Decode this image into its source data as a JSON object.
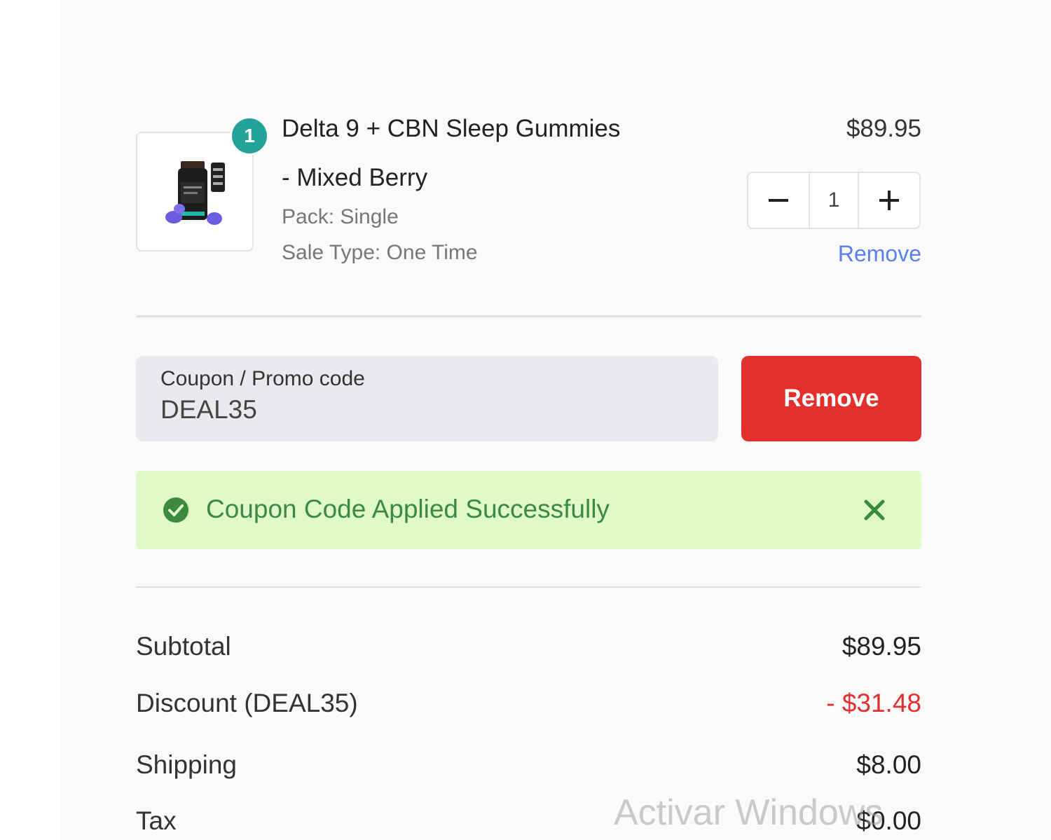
{
  "cart": {
    "item": {
      "quantity_badge": "1",
      "title_line1": "Delta 9 + CBN Sleep Gummies",
      "title_line2": "- Mixed Berry",
      "pack": "Pack: Single",
      "sale_type": "Sale Type: One Time",
      "price": "$89.95",
      "quantity": "1",
      "remove_label": "Remove",
      "image_icon": "product-bottle-icon"
    }
  },
  "coupon": {
    "label": "Coupon / Promo code",
    "value": "DEAL35",
    "button_label": "Remove"
  },
  "alert": {
    "message": "Coupon Code Applied Successfully",
    "icon": "check-circle-icon",
    "close_icon": "close-icon"
  },
  "summary": {
    "subtotal_label": "Subtotal",
    "subtotal_value": "$89.95",
    "discount_label": "Discount (DEAL35)",
    "discount_value": "- $31.48",
    "shipping_label": "Shipping",
    "shipping_value": "$8.00",
    "tax_label": "Tax",
    "tax_value": "$0.00"
  },
  "watermark": "Activar Windows",
  "colors": {
    "accent_teal": "#24a39b",
    "danger_red": "#e3302f",
    "link_blue": "#5b7ff0",
    "success_bg": "#dff9c9",
    "success_text": "#3b8a3e"
  }
}
